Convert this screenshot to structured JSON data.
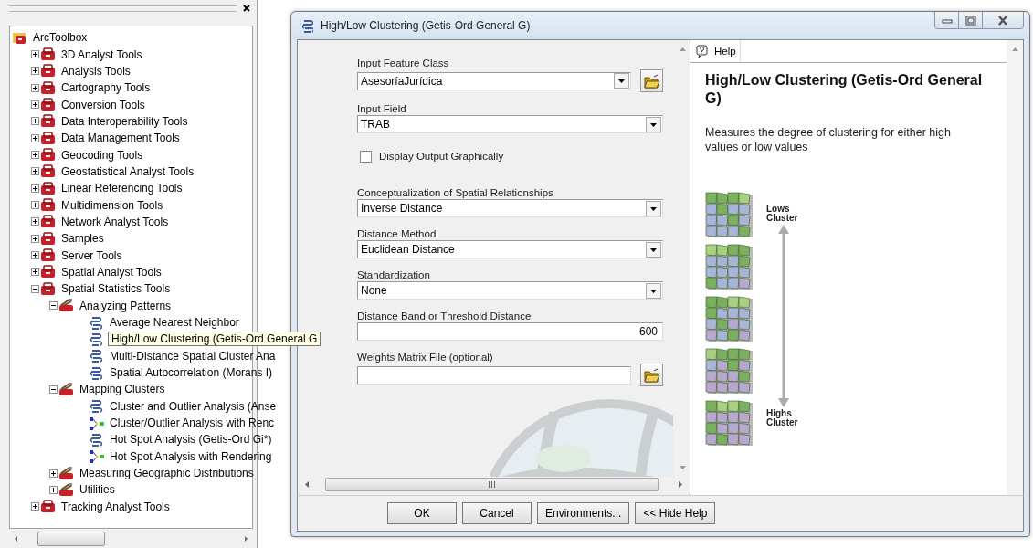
{
  "toolbox_panel": {
    "tree": [
      {
        "label": "ArcToolbox",
        "kind": "root",
        "children": [
          {
            "label": "3D Analyst Tools",
            "kind": "toolbox",
            "expanded": false
          },
          {
            "label": "Analysis Tools",
            "kind": "toolbox",
            "expanded": false
          },
          {
            "label": "Cartography Tools",
            "kind": "toolbox",
            "expanded": false
          },
          {
            "label": "Conversion Tools",
            "kind": "toolbox",
            "expanded": false
          },
          {
            "label": "Data Interoperability Tools",
            "kind": "toolbox",
            "expanded": false
          },
          {
            "label": "Data Management Tools",
            "kind": "toolbox",
            "expanded": false
          },
          {
            "label": "Geocoding Tools",
            "kind": "toolbox",
            "expanded": false
          },
          {
            "label": "Geostatistical Analyst Tools",
            "kind": "toolbox",
            "expanded": false
          },
          {
            "label": "Linear Referencing Tools",
            "kind": "toolbox",
            "expanded": false
          },
          {
            "label": "Multidimension Tools",
            "kind": "toolbox",
            "expanded": false
          },
          {
            "label": "Network Analyst Tools",
            "kind": "toolbox",
            "expanded": false
          },
          {
            "label": "Samples",
            "kind": "toolbox",
            "expanded": false
          },
          {
            "label": "Server Tools",
            "kind": "toolbox",
            "expanded": false
          },
          {
            "label": "Spatial Analyst Tools",
            "kind": "toolbox",
            "expanded": false
          },
          {
            "label": "Spatial Statistics Tools",
            "kind": "toolbox",
            "expanded": true,
            "children": [
              {
                "label": "Analyzing Patterns",
                "kind": "toolset",
                "expanded": true,
                "children": [
                  {
                    "label": "Average Nearest Neighbor",
                    "kind": "script",
                    "selected": false
                  },
                  {
                    "label": "High/Low Clustering (Getis-Ord General G",
                    "kind": "script",
                    "selected": true
                  },
                  {
                    "label": "Multi-Distance Spatial Cluster Ana",
                    "kind": "script",
                    "selected": false
                  },
                  {
                    "label": "Spatial Autocorrelation (Morans I)",
                    "kind": "script",
                    "selected": false
                  }
                ]
              },
              {
                "label": "Mapping Clusters",
                "kind": "toolset",
                "expanded": true,
                "children": [
                  {
                    "label": "Cluster and Outlier Analysis (Anse",
                    "kind": "script",
                    "selected": false
                  },
                  {
                    "label": "Cluster/Outlier Analysis with Renc",
                    "kind": "model",
                    "selected": false
                  },
                  {
                    "label": "Hot Spot Analysis (Getis-Ord Gi*)",
                    "kind": "script",
                    "selected": false
                  },
                  {
                    "label": "Hot Spot Analysis with Rendering",
                    "kind": "model",
                    "selected": false
                  }
                ]
              },
              {
                "label": "Measuring Geographic Distributions",
                "kind": "toolset",
                "expanded": false
              },
              {
                "label": "Utilities",
                "kind": "toolset",
                "expanded": false
              }
            ]
          },
          {
            "label": "Tracking Analyst Tools",
            "kind": "toolbox",
            "expanded": false
          }
        ]
      }
    ]
  },
  "dialog": {
    "title": "High/Low Clustering (Getis-Ord General G)",
    "parameters": [
      {
        "kind": "dropdown_browse",
        "label": "Input Feature Class",
        "value": "AsesoríaJurídica"
      },
      {
        "kind": "dropdown",
        "label": "Input Field",
        "value": "TRAB"
      },
      {
        "kind": "checkbox",
        "label": "Display Output Graphically",
        "checked": false
      },
      {
        "kind": "dropdown",
        "label": "Conceptualization of Spatial Relationships",
        "value": "Inverse Distance"
      },
      {
        "kind": "dropdown",
        "label": "Distance Method",
        "value": "Euclidean Distance"
      },
      {
        "kind": "dropdown",
        "label": "Standardization",
        "value": "None"
      },
      {
        "kind": "number",
        "label": "Distance Band or Threshold Distance",
        "value": "600"
      },
      {
        "kind": "text_browse",
        "label": "Weights Matrix File (optional)"
      }
    ],
    "buttons": [
      "OK",
      "Cancel",
      "Environments...",
      "<< Hide Help"
    ],
    "help": {
      "tab": "Help",
      "title": "High/Low Clustering (Getis-Ord General G)",
      "description": "Measures the degree of clustering for either high values or low values",
      "top_label": "Lows Cluster",
      "bottom_label": "Highs Cluster"
    }
  }
}
